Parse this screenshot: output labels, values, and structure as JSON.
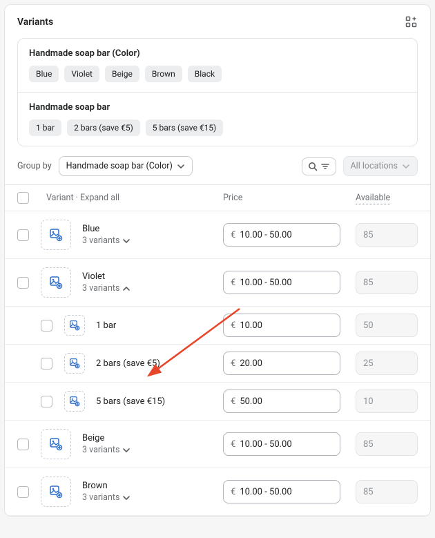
{
  "title": "Variants",
  "options": [
    {
      "name": "Handmade soap bar (Color)",
      "values": [
        "Blue",
        "Violet",
        "Beige",
        "Brown",
        "Black"
      ]
    },
    {
      "name": "Handmade soap bar",
      "values": [
        "1 bar",
        "2 bars (save €5)",
        "5 bars (save €15)"
      ]
    }
  ],
  "controls": {
    "group_by_label": "Group by",
    "group_by_value": "Handmade soap bar (Color)",
    "locations_label": "All locations"
  },
  "table_header": {
    "variant_label": "Variant",
    "expand_label": "Expand all",
    "separator": " · ",
    "price_label": "Price",
    "available_label": "Available"
  },
  "currency_symbol": "€",
  "rows": [
    {
      "name": "Blue",
      "sub": "3 variants",
      "expanded": false,
      "price": "10.00 - 50.00",
      "available": "85"
    },
    {
      "name": "Violet",
      "sub": "3 variants",
      "expanded": true,
      "price": "10.00 - 50.00",
      "available": "85",
      "children": [
        {
          "name": "1 bar",
          "price": "10.00",
          "available": "50"
        },
        {
          "name": "2 bars (save €5)",
          "price": "20.00",
          "available": "25"
        },
        {
          "name": "5 bars (save €15)",
          "price": "50.00",
          "available": "10"
        }
      ]
    },
    {
      "name": "Beige",
      "sub": "3 variants",
      "expanded": false,
      "price": "10.00 - 50.00",
      "available": "85"
    },
    {
      "name": "Brown",
      "sub": "3 variants",
      "expanded": false,
      "price": "10.00 - 50.00",
      "available": "85"
    }
  ]
}
